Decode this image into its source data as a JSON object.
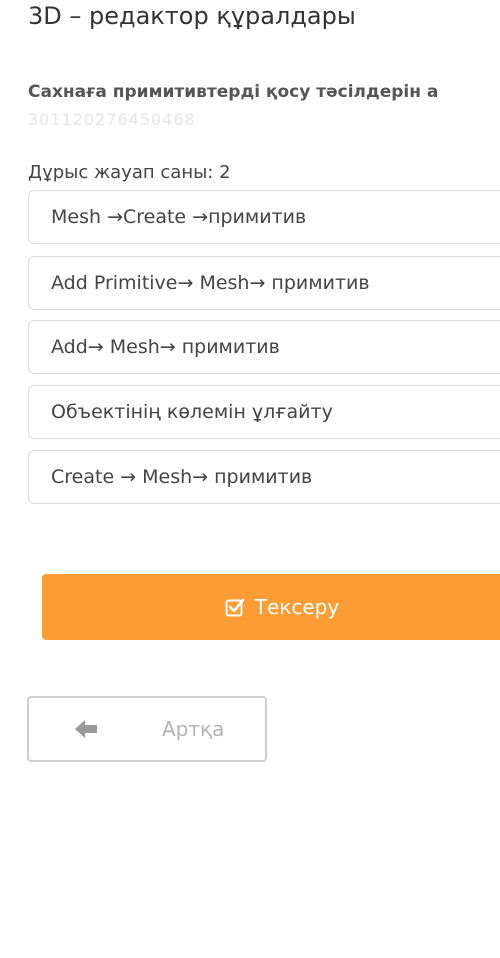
{
  "header": {
    "title": "3D – редактор құралдары"
  },
  "question": {
    "text": "Сахнаға примитивтерді қосу тәсілдерін а",
    "id": "301120276450468",
    "answers_count_label": "Дұрыс жауап саны: 2"
  },
  "options": [
    {
      "label": "Mesh →Create →примитив"
    },
    {
      "label": "Add Primitive→ Mesh→ примитив"
    },
    {
      "label": "Add→ Mesh→ примитив"
    },
    {
      "label": "Объектінің көлемін ұлғайту"
    },
    {
      "label": "Create → Mesh→ примитив"
    }
  ],
  "actions": {
    "check_label": "Тексеру",
    "check_icon": "checkbox-checked-icon",
    "back_label": "Артқа",
    "back_icon": "arrow-left-icon"
  },
  "colors": {
    "accent": "#fb9c34",
    "border": "#dcdcdc",
    "muted_text": "#b3b3b3"
  }
}
